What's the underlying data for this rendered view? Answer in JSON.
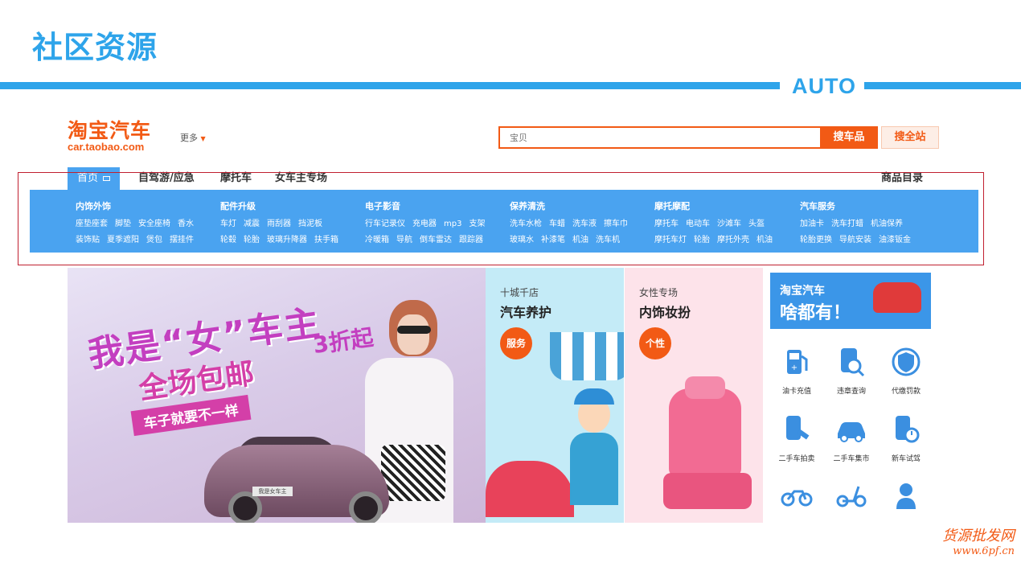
{
  "slide": {
    "title": "社区资源",
    "tag": "AUTO"
  },
  "header": {
    "logo_cn": "淘宝汽车",
    "logo_en": "car.taobao.com",
    "more": "更多",
    "search_placeholder": "宝贝",
    "search_car_button": "搜车品",
    "search_all_button": "搜全站"
  },
  "nav": {
    "items": [
      "首页",
      "自驾游/应急",
      "摩托车",
      "女车主专场"
    ],
    "catalog": "商品目录"
  },
  "categories": [
    {
      "title": "内饰外饰",
      "rows": [
        [
          "座垫座套",
          "脚垫",
          "安全座椅",
          "香水"
        ],
        [
          "装饰贴",
          "夏季遮阳",
          "煲包",
          "摆挂件"
        ]
      ]
    },
    {
      "title": "配件升级",
      "rows": [
        [
          "车灯",
          "减震",
          "雨刮器",
          "挡泥板"
        ],
        [
          "轮毂",
          "轮胎",
          "玻璃升降器",
          "扶手箱"
        ]
      ]
    },
    {
      "title": "电子影音",
      "rows": [
        [
          "行车记录仪",
          "充电器",
          "mp3",
          "支架"
        ],
        [
          "冷暖箱",
          "导航",
          "倒车雷达",
          "跟踪器"
        ]
      ]
    },
    {
      "title": "保养清洗",
      "rows": [
        [
          "洗车水枪",
          "车蜡",
          "洗车液",
          "擦车巾"
        ],
        [
          "玻璃水",
          "补漆笔",
          "机油",
          "洗车机"
        ]
      ]
    },
    {
      "title": "摩托摩配",
      "rows": [
        [
          "摩托车",
          "电动车",
          "沙滩车",
          "头盔"
        ],
        [
          "摩托车灯",
          "轮胎",
          "摩托外壳",
          "机油"
        ]
      ]
    },
    {
      "title": "汽车服务",
      "rows": [
        [
          "加油卡",
          "洗车打蜡",
          "机油保养"
        ],
        [
          "轮胎更换",
          "导航安装",
          "油漆钣金"
        ]
      ]
    }
  ],
  "banner_main": {
    "line1": "我是“女”车主",
    "line2": "全场包邮",
    "line3": "3折起",
    "slogan": "车子就要不一样",
    "plate": "我是女车主"
  },
  "card_service": {
    "subtitle": "十城千店",
    "title": "汽车养护",
    "badge": "服务"
  },
  "card_pink": {
    "subtitle": "女性专场",
    "title": "内饰妆扮",
    "badge": "个性"
  },
  "services_panel": {
    "head_line1": "淘宝汽车",
    "head_line2": "啥都有！",
    "items": [
      {
        "label": "油卡充值",
        "icon": "fuel-pump-icon"
      },
      {
        "label": "违章查询",
        "icon": "violation-search-icon"
      },
      {
        "label": "代缴罚款",
        "icon": "shield-icon"
      },
      {
        "label": "二手车拍卖",
        "icon": "auction-icon"
      },
      {
        "label": "二手车集市",
        "icon": "used-car-icon"
      },
      {
        "label": "新车试驾",
        "icon": "test-drive-icon"
      },
      {
        "label": "",
        "icon": "motorcycle-icon"
      },
      {
        "label": "",
        "icon": "scooter-icon"
      },
      {
        "label": "",
        "icon": "mechanic-icon"
      }
    ]
  },
  "watermark": {
    "line1": "货源批发网",
    "line2": "www.6pf.cn"
  },
  "colors": {
    "accent_blue": "#2ea4ea",
    "brand_orange": "#f25a15",
    "frame_red": "#c02030"
  }
}
